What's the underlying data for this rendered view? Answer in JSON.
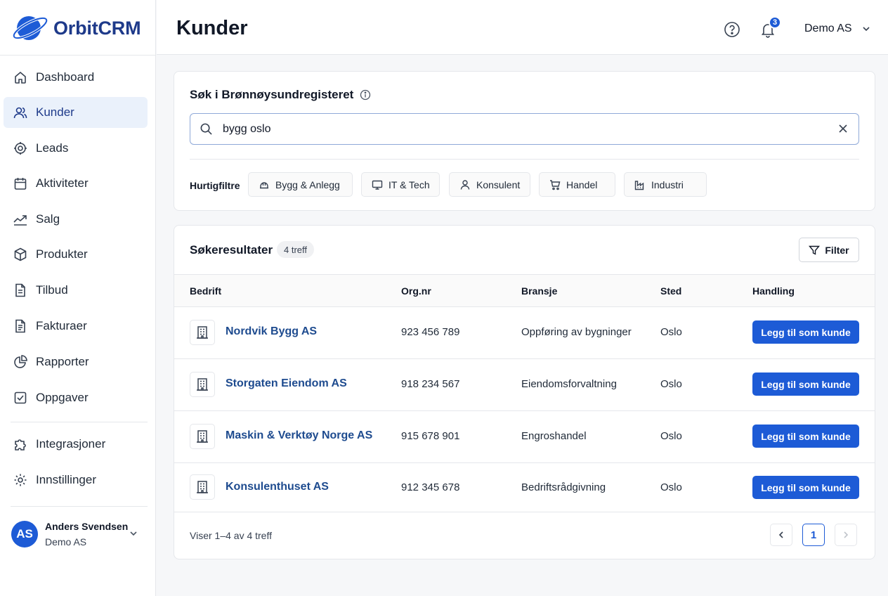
{
  "app": {
    "name": "OrbitCRM"
  },
  "sidebar": {
    "items": [
      {
        "label": "Dashboard",
        "icon": "home-icon"
      },
      {
        "label": "Kunder",
        "icon": "users-icon",
        "active": true
      },
      {
        "label": "Leads",
        "icon": "target-icon"
      },
      {
        "label": "Aktiviteter",
        "icon": "calendar-icon"
      },
      {
        "label": "Salg",
        "icon": "trend-icon"
      },
      {
        "label": "Produkter",
        "icon": "box-icon"
      },
      {
        "label": "Tilbud",
        "icon": "document-icon"
      },
      {
        "label": "Fakturaer",
        "icon": "invoice-icon"
      },
      {
        "label": "Rapporter",
        "icon": "pie-chart-icon"
      },
      {
        "label": "Oppgaver",
        "icon": "checkbox-icon"
      }
    ],
    "secondary": [
      {
        "label": "Integrasjoner",
        "icon": "puzzle-icon"
      },
      {
        "label": "Innstillinger",
        "icon": "gear-icon"
      }
    ],
    "user": {
      "initials": "AS",
      "name": "Anders Svendsen",
      "org": "Demo AS"
    }
  },
  "header": {
    "title": "Kunder",
    "notification_count": "3",
    "account": "Demo AS"
  },
  "search": {
    "title": "Søk i Brønnøysundregisteret",
    "value": "bygg oslo",
    "quick_filters_label": "Hurtigfiltre",
    "chips": [
      {
        "label": "Bygg & Anlegg",
        "icon": "helmet-icon"
      },
      {
        "label": "IT & Tech",
        "icon": "monitor-icon"
      },
      {
        "label": "Konsulent",
        "icon": "person-icon"
      },
      {
        "label": "Handel",
        "icon": "cart-icon"
      },
      {
        "label": "Industri",
        "icon": "factory-icon"
      }
    ]
  },
  "results": {
    "title": "Søkeresultater",
    "count_badge": "4 treff",
    "filter_label": "Filter",
    "columns": [
      "Bedrift",
      "Org.nr",
      "Bransje",
      "Sted",
      "Handling"
    ],
    "rows": [
      {
        "name": "Nordvik Bygg AS",
        "orgnr": "923 456 789",
        "industry": "Oppføring av bygninger",
        "city": "Oslo",
        "action": "Legg til som kunde"
      },
      {
        "name": "Storgaten Eiendom AS",
        "orgnr": "918 234 567",
        "industry": "Eiendomsforvaltning",
        "city": "Oslo",
        "action": "Legg til som kunde"
      },
      {
        "name": "Maskin & Verktøy Norge AS",
        "orgnr": "915 678 901",
        "industry": "Engroshandel",
        "city": "Oslo",
        "action": "Legg til som kunde"
      },
      {
        "name": "Konsulenthuset AS",
        "orgnr": "912 345 678",
        "industry": "Bedriftsrådgivning",
        "city": "Oslo",
        "action": "Legg til som kunde"
      }
    ],
    "summary": "Viser 1–4 av 4 treff",
    "current_page": "1"
  },
  "colors": {
    "primary": "#1d5bd6",
    "brand": "#1e3a8a",
    "active_bg": "#eaf1fb"
  }
}
